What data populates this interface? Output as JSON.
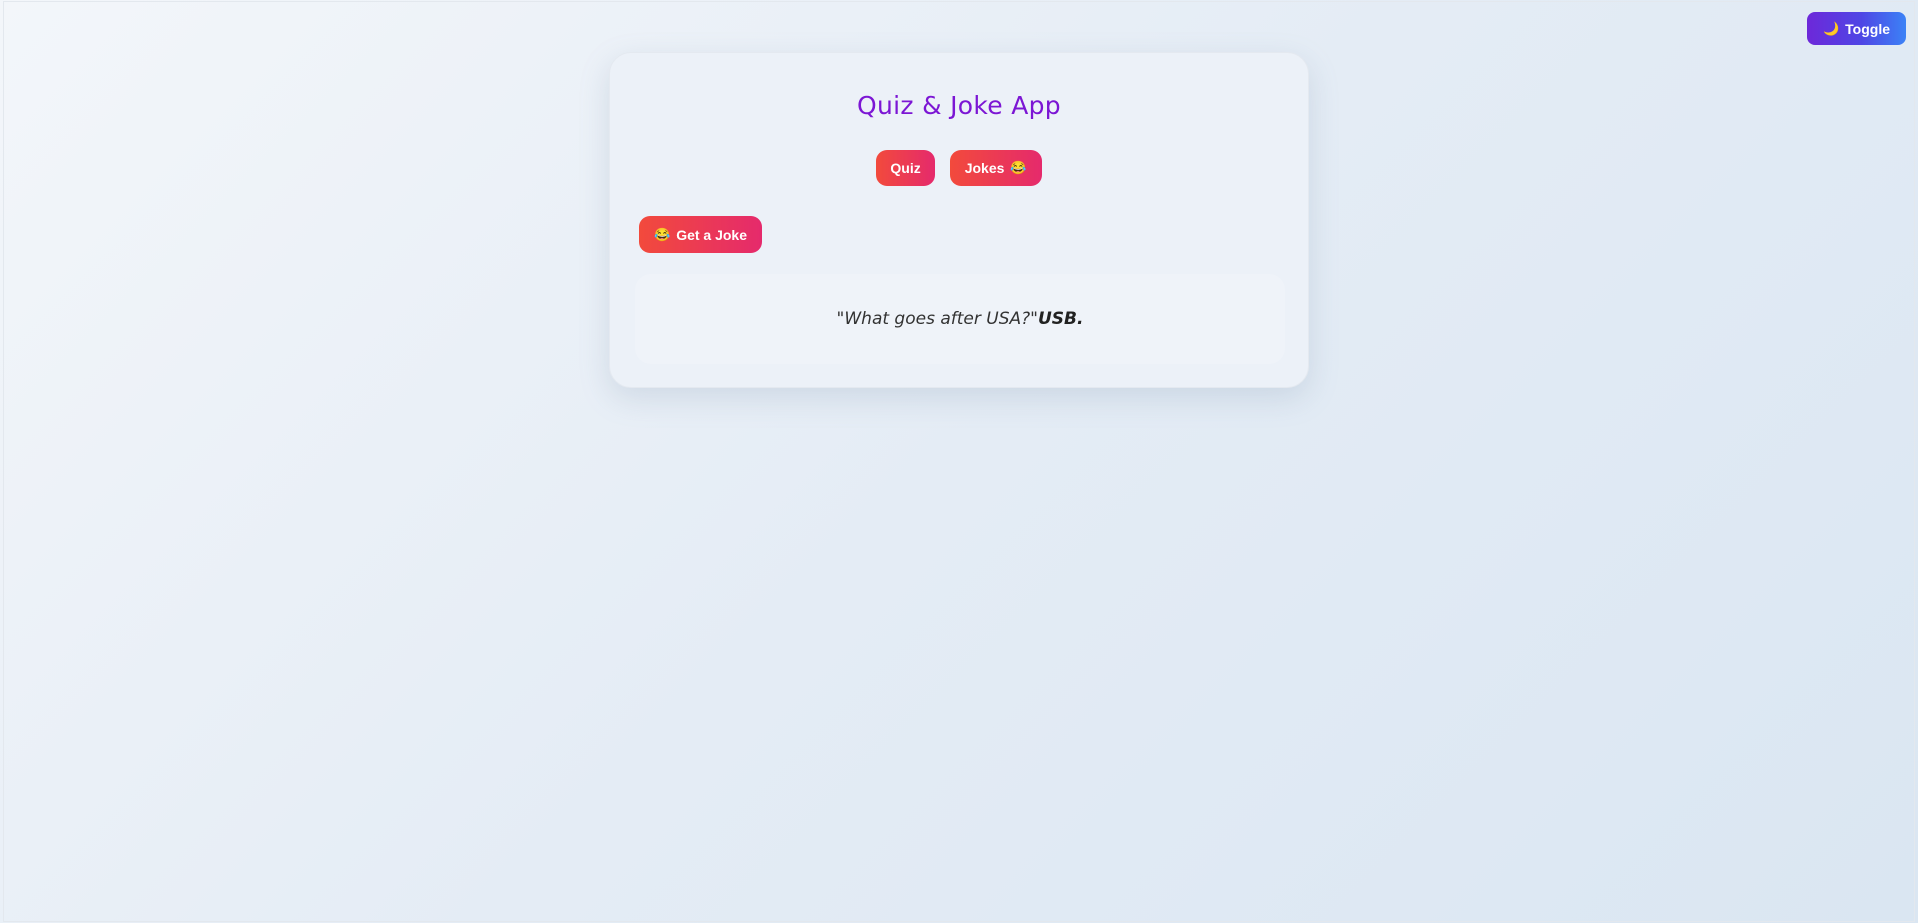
{
  "header": {
    "toggle_icon": "🌙",
    "toggle_label": "Toggle"
  },
  "app": {
    "title": "Quiz & Joke App",
    "tabs": [
      {
        "label": "Quiz",
        "icon": ""
      },
      {
        "label": "Jokes",
        "icon": "😂"
      }
    ],
    "get_joke_icon": "😂",
    "get_joke_label": "Get a Joke",
    "joke": {
      "setup": "\"What goes after USA?\"",
      "punchline": "USB."
    }
  },
  "colors": {
    "title": "#7c16d4",
    "button_gradient_start": "#f24a3c",
    "button_gradient_end": "#e52a6c",
    "toggle_gradient_start": "#6d28d9",
    "toggle_gradient_end": "#3b82f6"
  }
}
